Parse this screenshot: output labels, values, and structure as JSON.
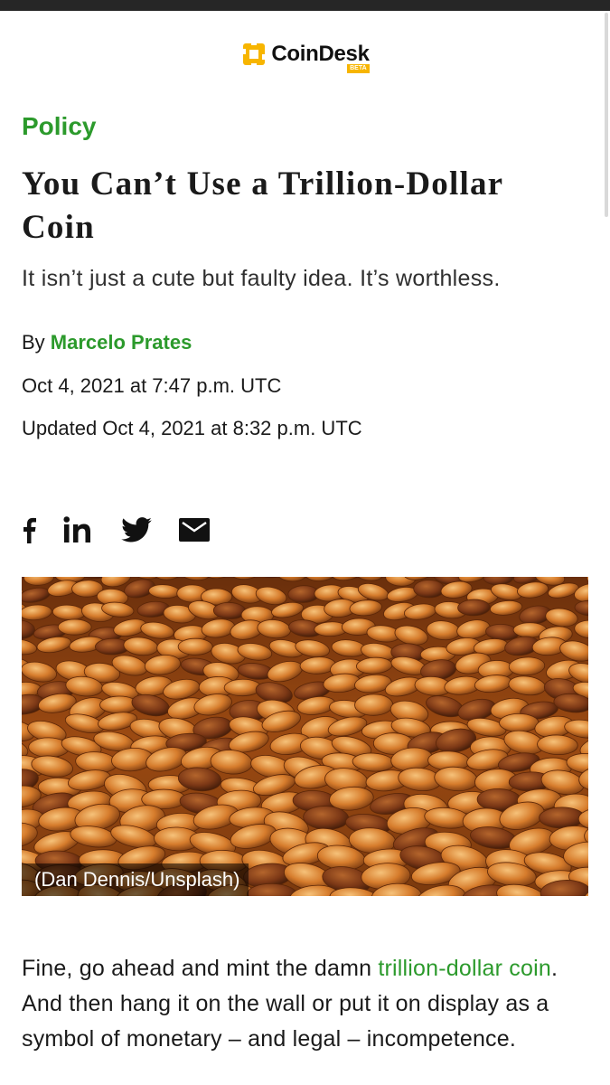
{
  "brand": {
    "name": "CoinDesk",
    "badge": "BETA",
    "accent": "#f7b500"
  },
  "article": {
    "category": "Policy",
    "title": "You Can’t Use a Trillion-Dollar Coin",
    "subtitle": "It isn’t just a cute but faulty idea. It’s worthless.",
    "byline_prefix": "By ",
    "author": "Marcelo Prates",
    "published": "Oct 4, 2021 at 7:47 p.m. UTC",
    "updated": "Updated Oct 4, 2021 at 8:32 p.m. UTC",
    "image_caption": "(Dan Dennis/Unsplash)",
    "body_start": "Fine, go ahead and mint the damn ",
    "body_link": "trillion-dollar coin",
    "body_rest": ". And then hang it on the wall or put it on display as a symbol of monetary – and legal – incompetence."
  },
  "share": [
    {
      "icon": "facebook-icon"
    },
    {
      "icon": "linkedin-icon"
    },
    {
      "icon": "twitter-icon"
    },
    {
      "icon": "email-icon"
    }
  ],
  "colors": {
    "category_green": "#2c9a2c",
    "link_green": "#2c9a2c",
    "text": "#1a1a1a",
    "topbar": "#262626"
  }
}
